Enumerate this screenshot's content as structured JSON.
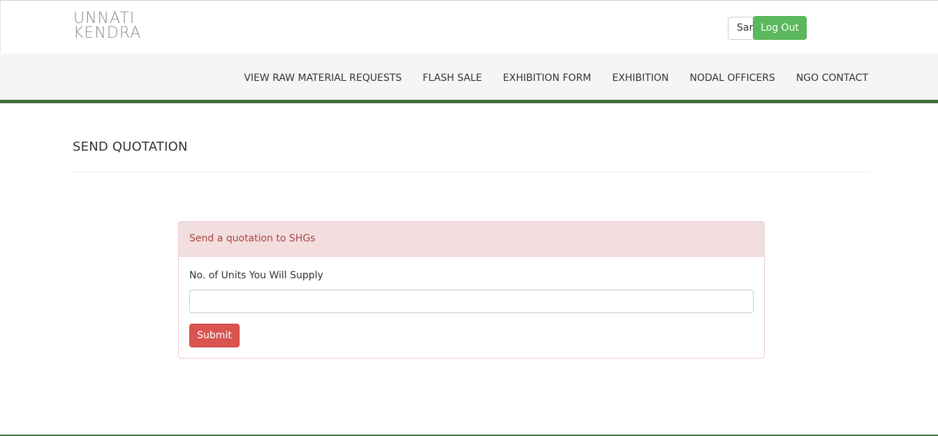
{
  "header": {
    "logo": {
      "line1": "UNNATI",
      "line2": "KENDRA"
    },
    "user_chip": "Sar",
    "logout_label": "Log Out"
  },
  "nav": {
    "items": [
      {
        "label": "VIEW RAW MATERIAL REQUESTS"
      },
      {
        "label": "FLASH SALE"
      },
      {
        "label": "EXHIBITION FORM"
      },
      {
        "label": "EXHIBITION"
      },
      {
        "label": "NODAL OFFICERS"
      },
      {
        "label": "NGO CONTACT"
      }
    ]
  },
  "page": {
    "title": "SEND QUOTATION"
  },
  "panel": {
    "heading": "Send a quotation to SHGs",
    "field_label": "No. of Units You Will Supply",
    "field_value": "",
    "submit_label": "Submit"
  },
  "colors": {
    "accent_green": "#5cb85c",
    "nav_border": "#3e6f3f",
    "danger": "#d9534f",
    "panel_heading_bg": "#f2dede",
    "panel_heading_text": "#a94442"
  }
}
